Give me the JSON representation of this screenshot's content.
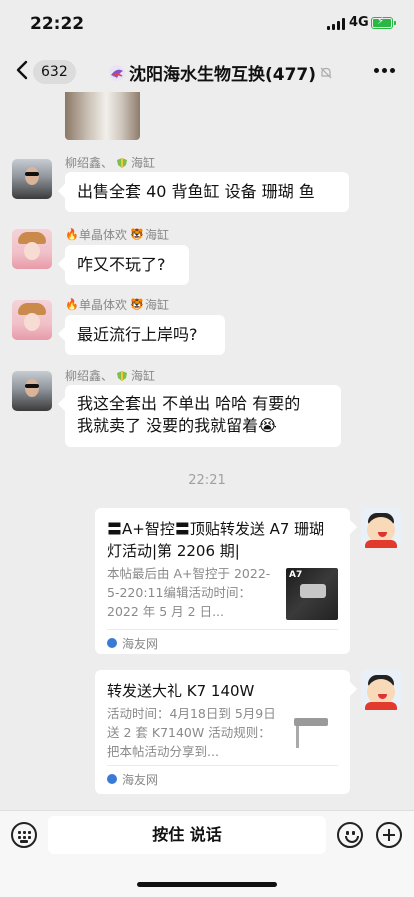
{
  "status": {
    "time": "22:22",
    "network": "4G"
  },
  "nav": {
    "unread_count": "632",
    "title": "沈阳海水生物互换(477)"
  },
  "messages": [
    {
      "sender": "柳绍鑫、",
      "group_tag": "海缸",
      "text": "出售全套 40 背鱼缸  设备  珊瑚 鱼"
    },
    {
      "sender": "单晶体欢",
      "group_tag": "海缸",
      "text": "咋又不玩了?"
    },
    {
      "sender": "单晶体欢",
      "group_tag": "海缸",
      "text": "最近流行上岸吗?"
    },
    {
      "sender": "柳绍鑫、",
      "group_tag": "海缸",
      "text_line1": "我这全套出  不单出  哈哈  有要的",
      "text_line2": "我就卖了  没要的我就留着",
      "emoji": "😭"
    }
  ],
  "timestamp": "22:21",
  "cards": [
    {
      "title": "〓A+智控〓顶贴转发送 A7 珊瑚灯活动|第 2206 期|",
      "desc": "本帖最后由 A+智控于 2022-5-220:11编辑活动时间：2022 年 5 月 2 日...",
      "thumb_label": "A7",
      "source": "海友网"
    },
    {
      "title": "转发送大礼 K7 140W",
      "desc": "活动时间：4月18日到 5月9日送 2 套 K7140W 活动规则：把本帖活动分享到...",
      "source": "海友网"
    }
  ],
  "input": {
    "voice_label": "按住 说话"
  },
  "colors": {
    "background": "#ededed",
    "bubble": "#ffffff",
    "battery": "#2ab743",
    "link_icon": "#3a7bd5"
  }
}
